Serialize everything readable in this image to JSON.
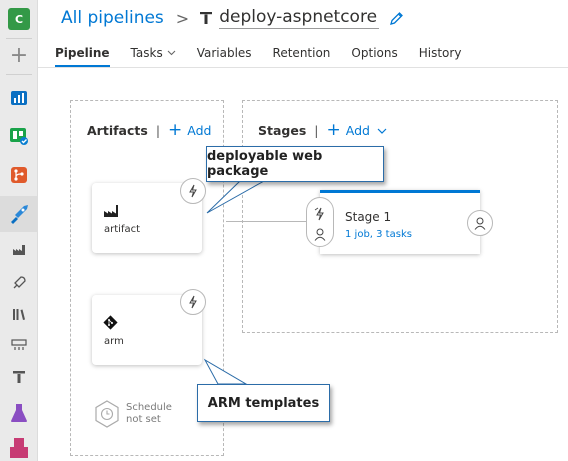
{
  "rail": {
    "org_initial": "C",
    "org_color": "#339947"
  },
  "header": {
    "breadcrumb_root": "All pipelines",
    "pipeline_name": "deploy-aspnetcore"
  },
  "tabs": [
    {
      "label": "Pipeline"
    },
    {
      "label": "Tasks"
    },
    {
      "label": "Variables"
    },
    {
      "label": "Retention"
    },
    {
      "label": "Options"
    },
    {
      "label": "History"
    }
  ],
  "artifacts": {
    "title": "Artifacts",
    "add_label": "Add",
    "items": [
      {
        "label": "artifact",
        "icon": "build-artifact-icon"
      },
      {
        "label": "arm",
        "icon": "git-repo-icon"
      }
    ],
    "schedule_line1": "Schedule",
    "schedule_line2": "not set"
  },
  "stages": {
    "title": "Stages",
    "add_label": "Add",
    "items": [
      {
        "name": "Stage 1",
        "summary": "1 job, 3 tasks"
      }
    ]
  },
  "callouts": {
    "web_package": "deployable web package",
    "arm_templates": "ARM templates"
  },
  "colors": {
    "accent": "#0078d4",
    "callout_border": "#2b6ca8"
  }
}
